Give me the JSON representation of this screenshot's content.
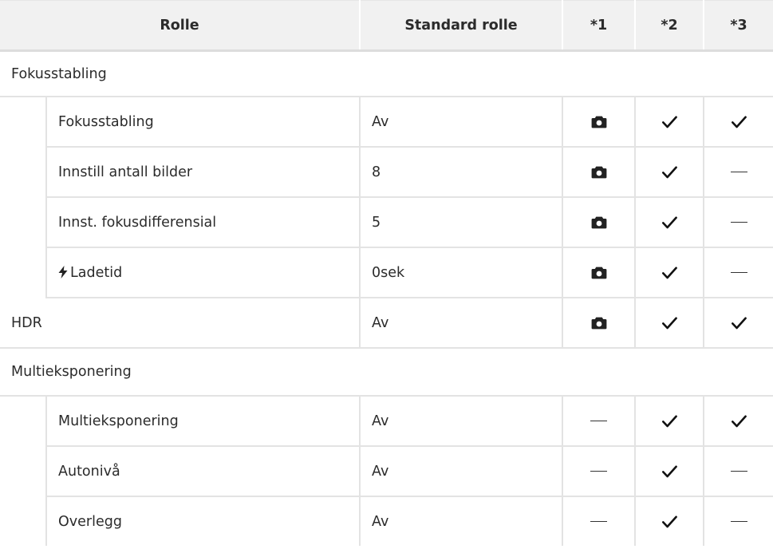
{
  "header": {
    "role": "Rolle",
    "default": "Standard rolle",
    "c1": "*1",
    "c2": "*2",
    "c3": "*3"
  },
  "groups": {
    "focus": "Fokusstabling",
    "hdr": {
      "label": "HDR",
      "value": "Av"
    },
    "multi": "Multieksponering"
  },
  "rows": [
    {
      "label": "Fokusstabling",
      "value": "Av"
    },
    {
      "label": "Innstill antall bilder",
      "value": "8"
    },
    {
      "label": "Innst. fokusdifferensial",
      "value": "5"
    },
    {
      "label": "Ladetid",
      "value": "0sek"
    },
    {
      "label": "Multieksponering",
      "value": "Av"
    },
    {
      "label": "Autonivå",
      "value": "Av"
    },
    {
      "label": "Overlegg",
      "value": "Av"
    }
  ],
  "icons": {
    "camera": "camera-icon",
    "check": "checkmark-icon",
    "dash": "dash-icon",
    "flash": "flash-icon"
  },
  "colors": {
    "header_bg": "#f1f1f1",
    "border": "#e3e3e3",
    "text": "#2b2b2b"
  }
}
